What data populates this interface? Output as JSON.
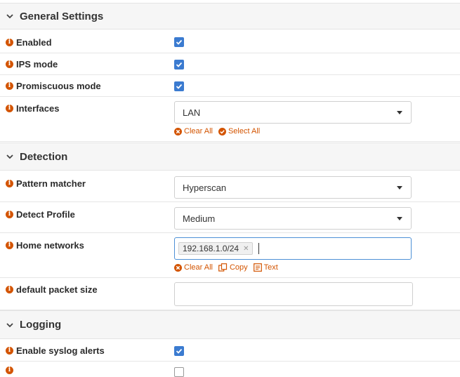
{
  "general": {
    "title": "General Settings",
    "enabled_label": "Enabled",
    "ips_label": "IPS mode",
    "promisc_label": "Promiscuous mode",
    "interfaces_label": "Interfaces",
    "interfaces_value": "LAN",
    "clear_all": "Clear All",
    "select_all": "Select All"
  },
  "detection": {
    "title": "Detection",
    "pattern_label": "Pattern matcher",
    "pattern_value": "Hyperscan",
    "profile_label": "Detect Profile",
    "profile_value": "Medium",
    "home_label": "Home networks",
    "home_tag": "192.168.1.0/24",
    "clear_all": "Clear All",
    "copy": "Copy",
    "text": "Text",
    "packet_label": "default packet size",
    "packet_value": ""
  },
  "logging": {
    "title": "Logging",
    "syslog_label": "Enable syslog alerts"
  },
  "colors": {
    "accent": "#3b7bd0",
    "info_icon": "#d35400",
    "link": "#d35400"
  }
}
